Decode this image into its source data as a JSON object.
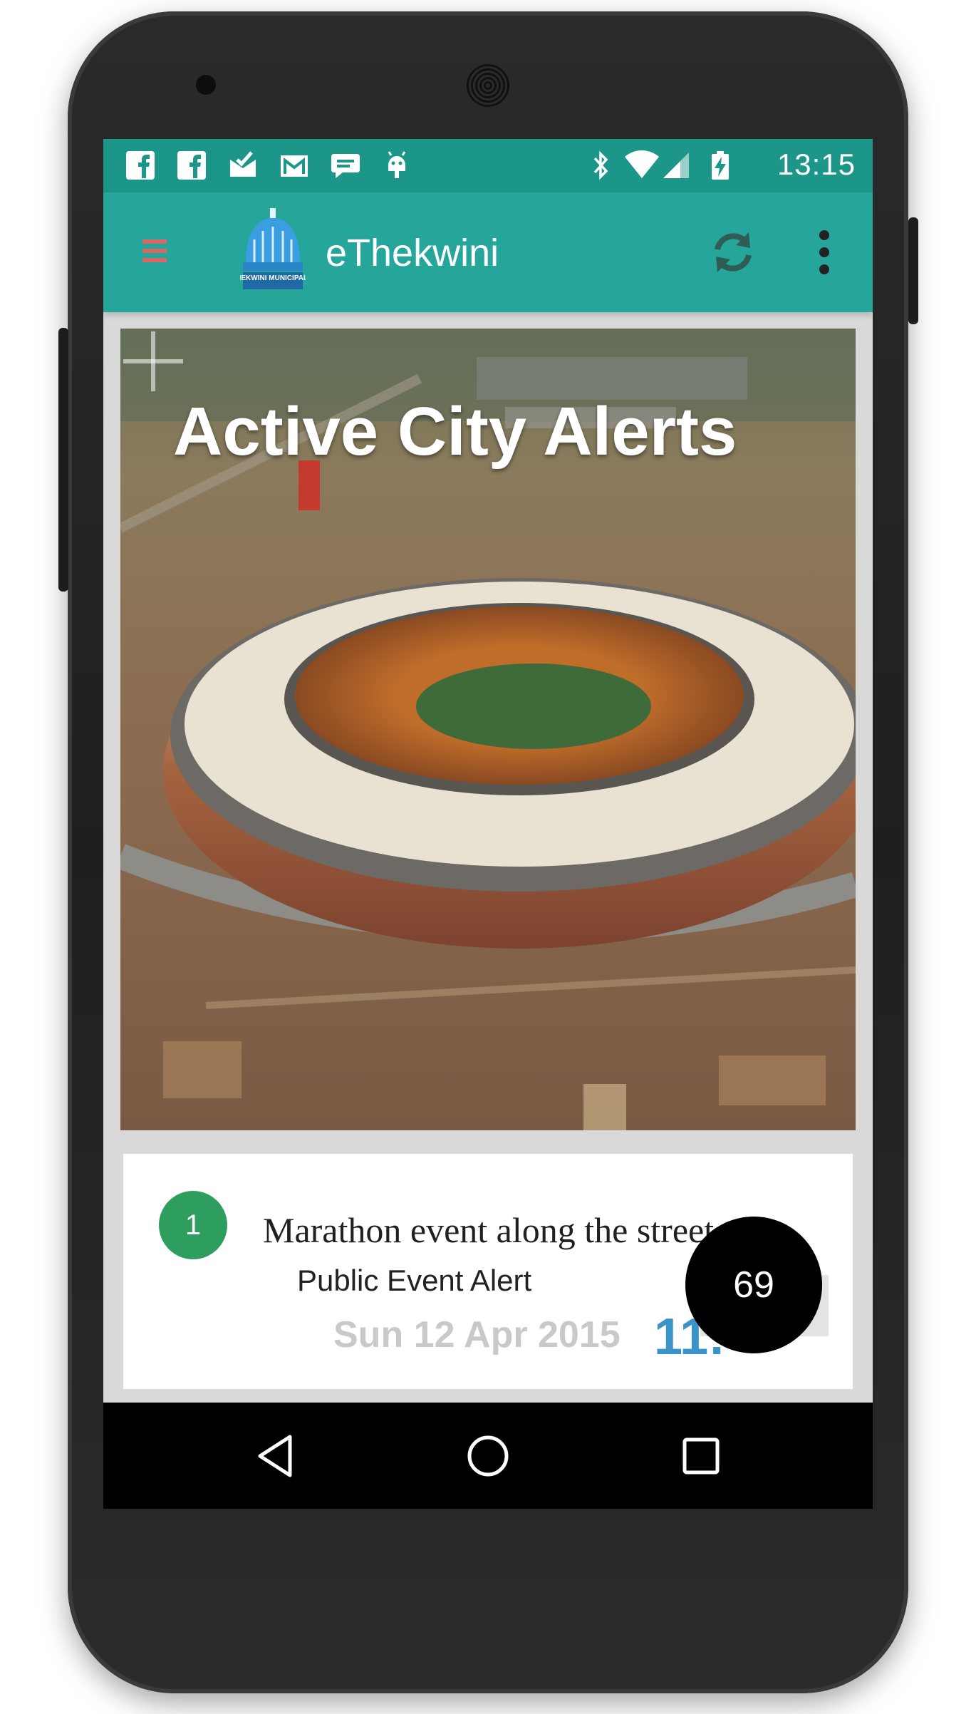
{
  "status_bar": {
    "notification_icons": [
      "facebook-icon",
      "facebook-icon",
      "email-check-icon",
      "gmail-icon",
      "chat-icon",
      "android-icon"
    ],
    "system_icons": [
      "bluetooth-icon",
      "wifi-icon",
      "signal-icon",
      "battery-charging-icon"
    ],
    "time": "13:15"
  },
  "toolbar": {
    "title": "eThekwini",
    "logo_text": "ETHEKWINI MUNICIPALITY",
    "icons": [
      "menu-icon",
      "refresh-icon",
      "overflow-menu-icon"
    ]
  },
  "hero": {
    "title": "Active City Alerts",
    "add_icon": "plus-icon"
  },
  "alerts": [
    {
      "index": "1",
      "title": "Marathon event along the street",
      "type": "Public Event Alert",
      "date": "Sun 12 Apr 2015",
      "time": "11:"
    }
  ],
  "fab": {
    "count": "69"
  },
  "nav_bar": {
    "buttons": [
      "back-icon",
      "home-icon",
      "recents-icon"
    ]
  },
  "colors": {
    "status_bar": "#1b9688",
    "toolbar": "#26a69a",
    "badge": "#2e9e5e",
    "time_text": "#3a93c9",
    "date_text": "#c9c9c9"
  }
}
